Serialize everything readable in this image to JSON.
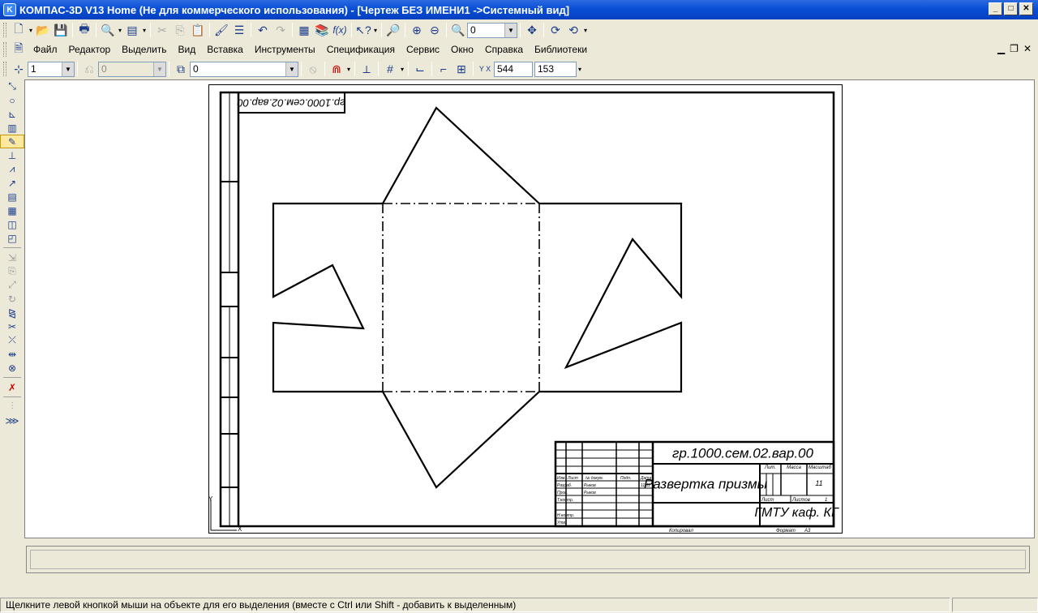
{
  "window": {
    "title": "КОМПАС-3D V13 Home (Не для коммерческого использования) - [Чертеж БЕЗ ИМЕНИ1 ->Системный вид]"
  },
  "std_toolbar": {
    "zoom_value": "0"
  },
  "menu": {
    "items": [
      "Файл",
      "Редактор",
      "Выделить",
      "Вид",
      "Вставка",
      "Инструменты",
      "Спецификация",
      "Сервис",
      "Окно",
      "Справка",
      "Библиотеки"
    ]
  },
  "props_toolbar": {
    "style_value": "1",
    "layer_value": "0",
    "view_value": "0",
    "coord_x": "544",
    "coord_y": "153"
  },
  "drawing": {
    "designation": "гр.1000.сем.02.вар.00",
    "designation_rotated": "гр.1000.сем.02.вар.00",
    "title": "Развертка призмы",
    "organization": "ГМТУ каф. КГ",
    "sheets_total": "11",
    "col_lit": "Лит.",
    "col_mass": "Масса",
    "col_scale": "Масштаб",
    "label_sheet": "Лист",
    "label_sheets": "Листов",
    "sheets_num": "1",
    "row_izm": "Изм.",
    "row_list": "Лист",
    "row_doc": "№ докум.",
    "row_sign": "Подп.",
    "row_date": "Дата",
    "row_razrab": "Разраб.",
    "row_prov": "Пров.",
    "row_tkontr": "Т.контр.",
    "row_nkontr": "Н.контр.",
    "row_utv": "Утв.",
    "razrab_name": "Рыков",
    "prov_name": "Рыков",
    "date_val": "11.11",
    "copied": "Копировал",
    "format_label": "Формат",
    "format_value": "A3",
    "axis_y": "Y",
    "axis_x": "X"
  },
  "status": {
    "hint": "Щелкните левой кнопкой мыши на объекте для его выделения (вместе с Ctrl или Shift - добавить к выделенным)"
  }
}
